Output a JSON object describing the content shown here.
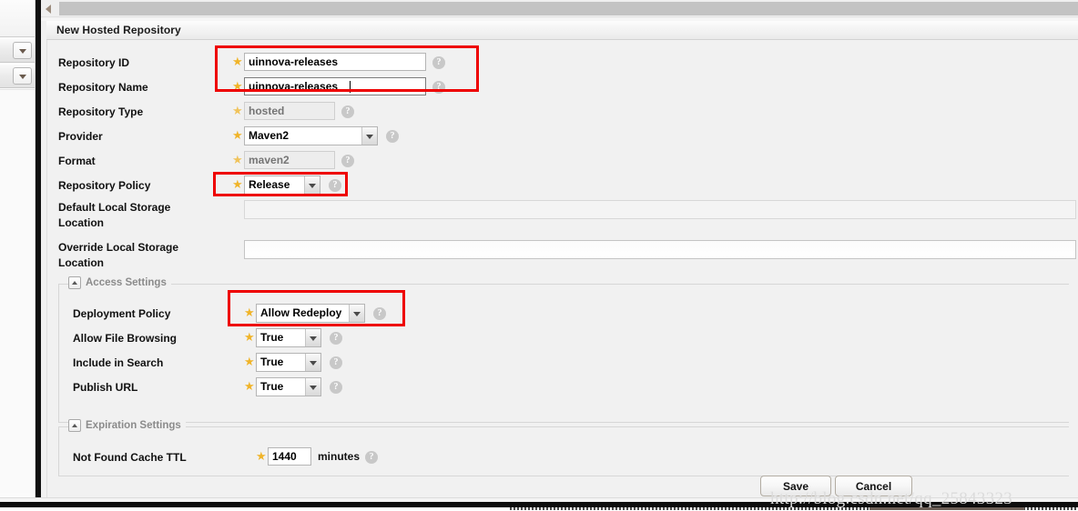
{
  "window": {
    "panel_title": "New Hosted Repository",
    "watermark": "http://blog.csdn.net/qq_25843323"
  },
  "sidebar": {
    "panels": [
      {
        "name": "collapsed-panel-1",
        "arrow": "chevron-down-icon"
      },
      {
        "name": "collapsed-panel-2",
        "arrow": "chevron-down-icon"
      }
    ],
    "scroll_left_arrow": "chevron-left-icon"
  },
  "form": {
    "required_marker": "★",
    "help_glyph": "?",
    "fields": [
      {
        "label": "Repository ID",
        "type": "text",
        "value": "uinnova-releases",
        "placeholder": "",
        "required": true,
        "disabled": false,
        "focused": false,
        "highlighted": true
      },
      {
        "label": "Repository Name",
        "type": "text",
        "value": "uinnova-releases",
        "placeholder": "",
        "required": true,
        "disabled": false,
        "focused": true,
        "highlighted": true
      },
      {
        "label": "Repository Type",
        "type": "text",
        "value": "hosted",
        "placeholder": "hosted",
        "required": true,
        "disabled": true,
        "focused": false,
        "highlighted": false
      },
      {
        "label": "Provider",
        "type": "select",
        "value": "Maven2",
        "required": true,
        "disabled": false,
        "highlighted": false
      },
      {
        "label": "Format",
        "type": "text",
        "value": "maven2",
        "placeholder": "maven2",
        "required": true,
        "disabled": true,
        "focused": false,
        "highlighted": false
      },
      {
        "label": "Repository Policy",
        "type": "select",
        "value": "Release",
        "required": true,
        "disabled": false,
        "highlighted": true
      },
      {
        "label": "Default Local Storage Location",
        "type": "text-wide",
        "value": "",
        "placeholder": "",
        "required": false,
        "disabled": true,
        "highlighted": false
      },
      {
        "label": "Override Local Storage Location",
        "type": "text-wide",
        "value": "",
        "placeholder": "",
        "required": false,
        "disabled": false,
        "highlighted": false
      }
    ],
    "access_settings": {
      "legend": "Access Settings",
      "toggle": "collapse-icon",
      "fields": [
        {
          "label": "Deployment Policy",
          "type": "select",
          "value": "Allow Redeploy",
          "required": true,
          "highlighted": true
        },
        {
          "label": "Allow File Browsing",
          "type": "select",
          "value": "True",
          "required": true,
          "highlighted": false
        },
        {
          "label": "Include in Search",
          "type": "select",
          "value": "True",
          "required": true,
          "highlighted": false
        },
        {
          "label": "Publish URL",
          "type": "select",
          "value": "True",
          "required": true,
          "highlighted": false
        }
      ]
    },
    "expiration_settings": {
      "legend": "Expiration Settings",
      "toggle": "collapse-icon",
      "ttl_label": "Not Found Cache TTL",
      "ttl_value": "1440",
      "ttl_units": "minutes",
      "required": true
    },
    "actions": {
      "save_label": "Save",
      "cancel_label": "Cancel"
    }
  },
  "colors": {
    "annotation": "#ee0000",
    "required_star": "#f0b429",
    "header_text": "#1b1b1b"
  }
}
